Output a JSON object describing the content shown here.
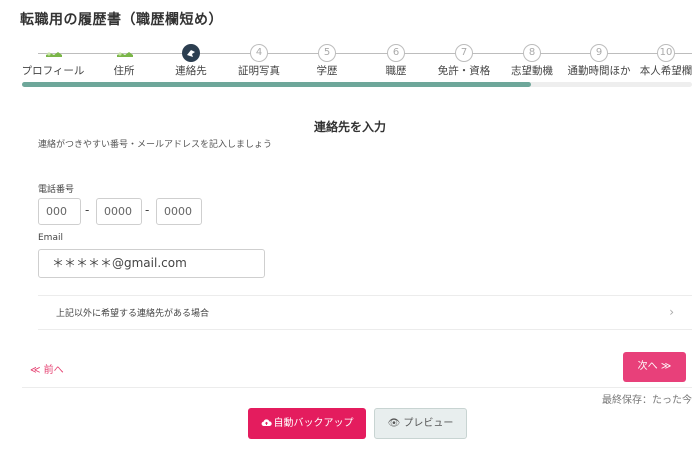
{
  "page": {
    "title": "転職用の履歴書（職歴欄短め）"
  },
  "stepper": {
    "steps": [
      {
        "number": "",
        "label": "プロフィール",
        "state": "done"
      },
      {
        "number": "",
        "label": "住所",
        "state": "done"
      },
      {
        "number": "",
        "label": "連絡先",
        "state": "current"
      },
      {
        "number": "4",
        "label": "証明写真",
        "state": "todo"
      },
      {
        "number": "5",
        "label": "学歴",
        "state": "todo"
      },
      {
        "number": "6",
        "label": "職歴",
        "state": "todo"
      },
      {
        "number": "7",
        "label": "免許・資格",
        "state": "todo"
      },
      {
        "number": "8",
        "label": "志望動機",
        "state": "todo"
      },
      {
        "number": "9",
        "label": "通勤時間ほか",
        "state": "todo"
      },
      {
        "number": "10",
        "label": "本人希望欄",
        "state": "todo"
      }
    ],
    "progress_fraction": 0.76
  },
  "contact": {
    "title": "連絡先を入力",
    "subtitle": "連絡がつきやすい番号・メールアドレスを記入しましょう",
    "phone_label": "電話番号",
    "phone_parts": [
      "000",
      "0000",
      "0000"
    ],
    "phone_separator": "-",
    "email_label": "Email",
    "email_value": "＊＊＊＊＊@gmail.com",
    "other_contact_label": "上記以外に希望する連絡先がある場合"
  },
  "nav": {
    "prev_label": "≪ 前へ",
    "next_label": "次へ ≫"
  },
  "status": {
    "saved_text": "最終保存：たった今"
  },
  "actions": {
    "backup_label": "自動バックアップ",
    "preview_label": "プレビュー"
  },
  "colors": {
    "accent": "#e8407a",
    "progress": "#6ea79a",
    "current_step": "#2c3e50",
    "done_step": "#7ab648"
  }
}
